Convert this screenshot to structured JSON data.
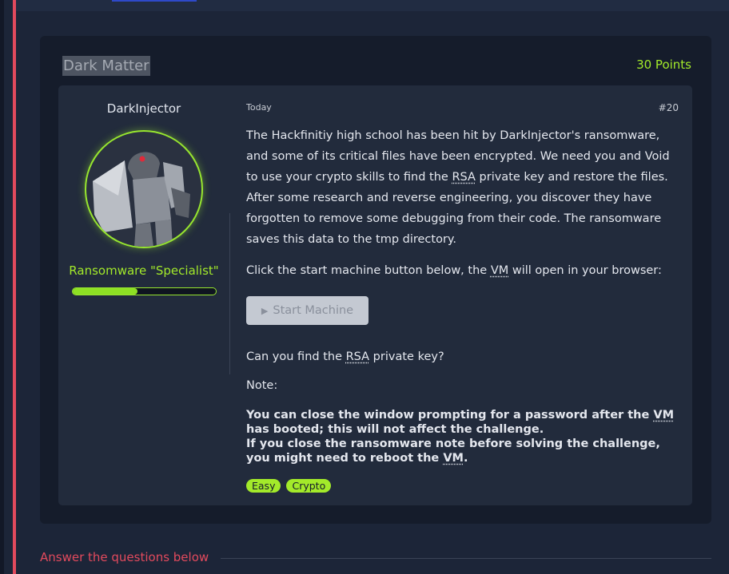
{
  "task": {
    "title": "Dark Matter",
    "points": "30 Points"
  },
  "author": {
    "name": "DarkInjector",
    "rank": "Ransomware \"Specialist\"",
    "progress": 0.45
  },
  "meta": {
    "date": "Today",
    "number": "#20"
  },
  "description": {
    "paragraph1_a": "The Hackfinitiy high school has been hit by DarkInjector's ransomware, and some of its critical files have been encrypted. We need you and Void to use your crypto skills to find the ",
    "abbr_rsa": "RSA",
    "paragraph1_b": " private key and restore the files. After some research and reverse engineering, you discover they have forgotten to remove some debugging from their code. The ransomware saves this data to the tmp directory.",
    "paragraph2_a": "Click the start machine button below, the ",
    "abbr_vm": "VM",
    "paragraph2_b": " will open in your browser:",
    "start_button": "Start Machine",
    "question_a": "Can you find the ",
    "question_b": " private key?",
    "note_label": "Note:",
    "note1_a": "You can close the window prompting for a password after the ",
    "note1_b": " has booted; this will not affect the challenge.",
    "note2_a": "If you close the ransomware note before solving the challenge, you might need to reboot the ",
    "note2_b": "."
  },
  "tags": [
    "Easy",
    "Crypto"
  ],
  "answers": {
    "title": "Answer the questions below"
  },
  "colors": {
    "accent_green": "#a3ea2a",
    "accent_red": "#e24a5d",
    "card_bg": "#151c2b"
  }
}
